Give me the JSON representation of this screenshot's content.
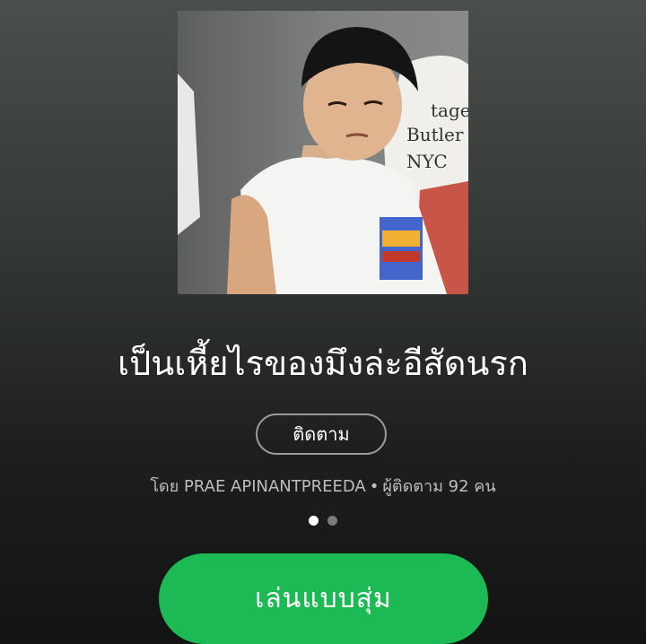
{
  "playlist": {
    "title": "เป็นเหี้ยไรของมึงล่ะอีสัดนรก",
    "follow_label": "ติดตาม",
    "by_prefix": "โดย",
    "owner": "PRAE APINANTPREEDA",
    "separator": "•",
    "followers_text": "ผู้ติดตาม 92 คน",
    "play_label": "เล่นแบบสุ่ม",
    "cover_shirt_text": [
      "tage",
      "Butler",
      "NYC"
    ]
  },
  "pager": {
    "count": 2,
    "active_index": 0
  },
  "colors": {
    "accent": "#1db954",
    "background_top": "#4a4f4c",
    "background_bottom": "#121312",
    "meta_text": "#bdbdbd"
  }
}
